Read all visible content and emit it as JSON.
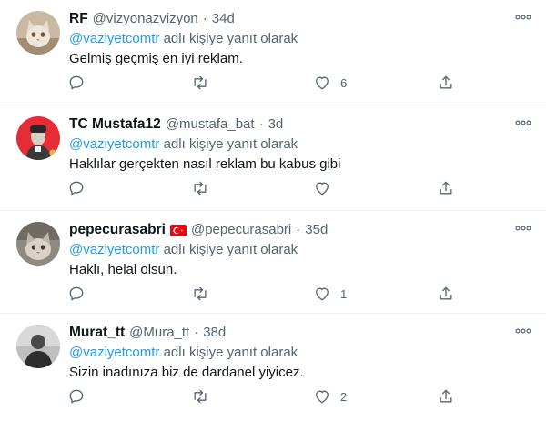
{
  "reply_prefix": "@vaziyetcomtr",
  "reply_suffix": " adlı kişiye yanıt olarak",
  "tweets": [
    {
      "name": "RF",
      "handle": "@vizyonazvizyon",
      "sep": "·",
      "time": "34d",
      "text": "Gelmiş geçmiş en iyi reklam.",
      "likes": "6",
      "has_flag": false,
      "avatar": "cat-icon"
    },
    {
      "name": "TC Mustafa12",
      "handle": "@mustafa_bat",
      "sep": "·",
      "time": "3d",
      "text": "Haklılar gerçekten nasıl reklam bu kabus gibi",
      "likes": "",
      "has_flag": false,
      "avatar": "portrait-icon"
    },
    {
      "name": "pepecurasabri",
      "handle": "@pepecurasabri",
      "sep": "·",
      "time": "35d",
      "text": "Haklı, helal olsun.",
      "likes": "1",
      "has_flag": true,
      "avatar": "cat-icon"
    },
    {
      "name": "Murat_tt",
      "handle": "@Mura_tt",
      "sep": "·",
      "time": "38d",
      "text": "Sizin inadınıza biz de dardanel yiyicez.",
      "likes": "2",
      "has_flag": false,
      "avatar": "person-icon"
    }
  ],
  "colors": {
    "accent": "#1d9bf0",
    "secondary": "#536471",
    "text": "#0f1419",
    "border": "#eff3f4"
  }
}
